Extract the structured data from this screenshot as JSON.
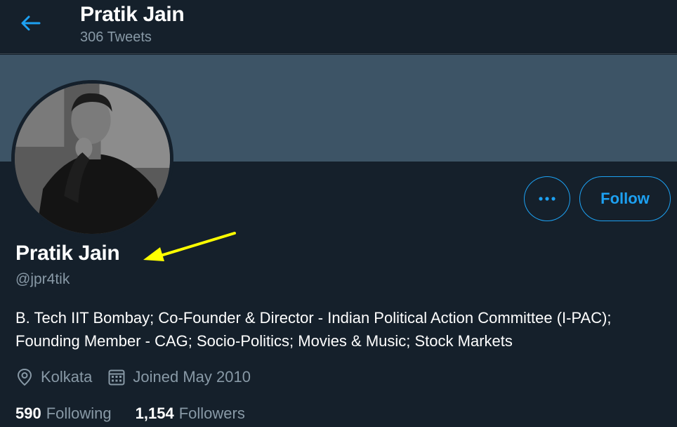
{
  "header": {
    "name": "Pratik Jain",
    "tweet_count": "306 Tweets",
    "back_icon": "arrow-left-icon"
  },
  "profile": {
    "display_name": "Pratik Jain",
    "handle": "@jpr4tik",
    "bio": "B. Tech IIT Bombay; Co-Founder & Director - Indian Political Action Committee (I-PAC); Founding Member - CAG; Socio-Politics; Movies & Music; Stock Markets",
    "location": "Kolkata",
    "joined": "Joined May 2010"
  },
  "actions": {
    "more_icon": "more-horizontal-icon",
    "follow_label": "Follow"
  },
  "stats": {
    "following_count": "590",
    "following_label": "Following",
    "followers_count": "1,154",
    "followers_label": "Followers"
  },
  "colors": {
    "background": "#15202b",
    "banner": "#3d5466",
    "accent": "#1da1f2",
    "secondary_text": "#8899a6",
    "annotation": "#ffff00"
  }
}
